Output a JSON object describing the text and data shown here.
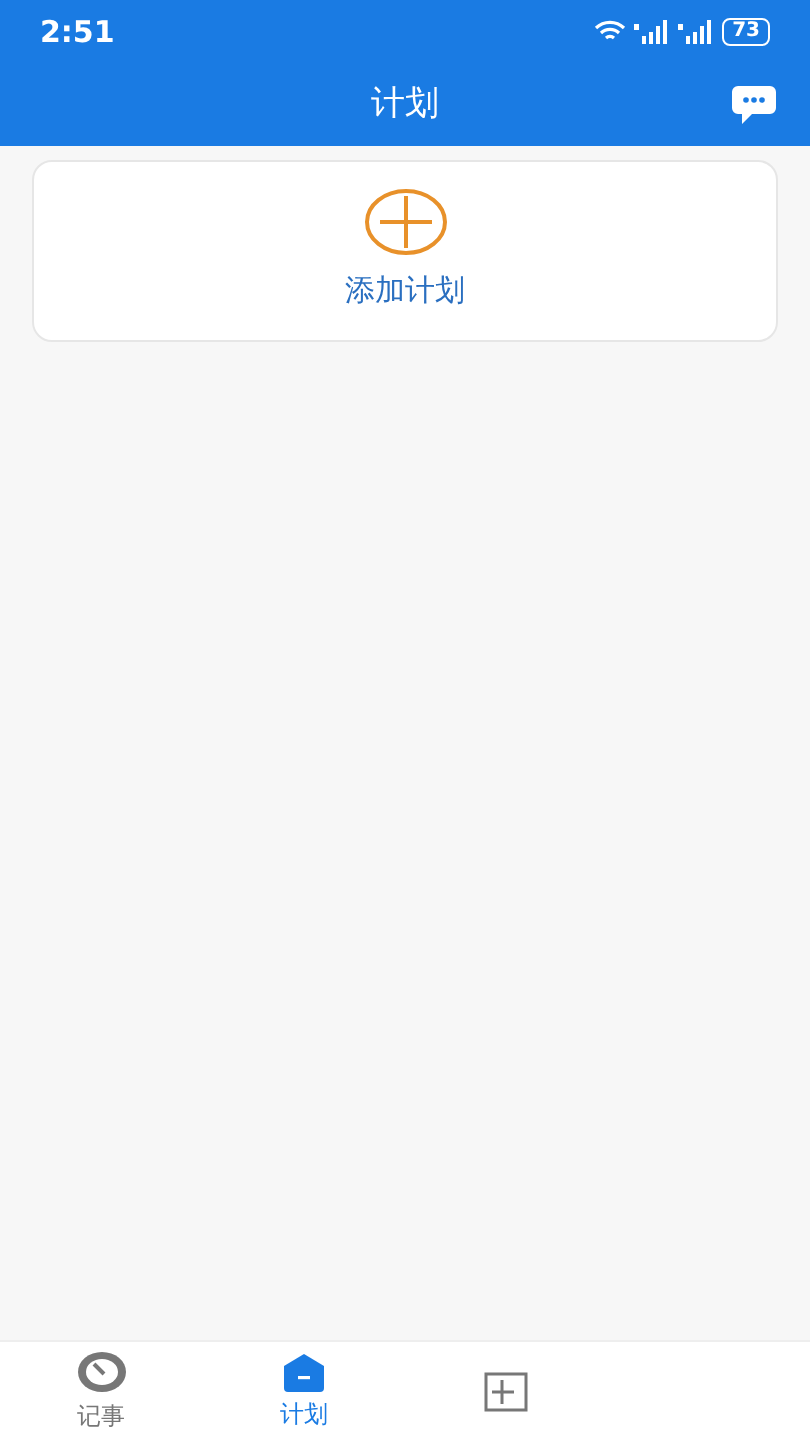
{
  "status_bar": {
    "time": "2:51",
    "battery": "73"
  },
  "header": {
    "title": "计划"
  },
  "add_card": {
    "label": "添加计划"
  },
  "tabs": [
    {
      "kind": "timer",
      "label": "记事",
      "selected": false
    },
    {
      "kind": "plan",
      "label": "计划",
      "selected": true
    },
    {
      "kind": "calendar",
      "selected": false
    }
  ]
}
